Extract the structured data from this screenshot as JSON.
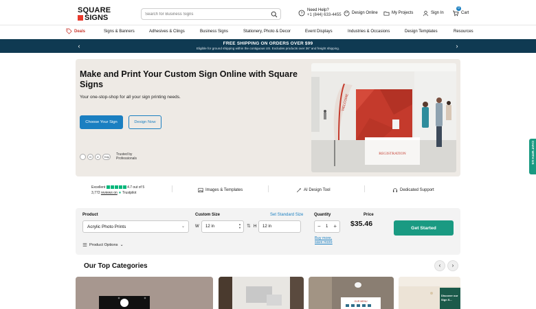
{
  "brand": {
    "line1": "SQUARE",
    "line2": "SIGNS",
    "accent": "#e8392c"
  },
  "search": {
    "placeholder": "Search for Business Signs"
  },
  "header": {
    "help_title": "Need Help?",
    "help_phone": "+1 (844) 633-4455",
    "design_online": "Design Online",
    "my_projects": "My Projects",
    "sign_in": "Sign In",
    "cart": "Cart",
    "cart_count": "0"
  },
  "nav": {
    "items": [
      "Deals",
      "Signs & Banners",
      "Adhesives & Clings",
      "Business Signs",
      "Stationery, Photo & Decor",
      "Event Displays",
      "Industries & Occasions",
      "Design Templates",
      "Resources"
    ]
  },
  "shipping": {
    "title": "FREE SHIPPING ON ORDERS OVER $99",
    "subtitle": "Eligible for ground shipping within the contiguous US. Excludes products over 36\" and freight shipping.",
    "bg": "#0f3a52"
  },
  "hero": {
    "title": "Make and Print Your Custom Sign Online with Square Signs",
    "subtitle": "Your one-stop-shop for all your sign printing needs.",
    "primary_cta": "Choose Your Sign",
    "secondary_cta": "Design Now",
    "trust_badges": [
      "G",
      "é",
      "Yelp"
    ],
    "trust_label": "Trusted by Professionals",
    "flag_text": "WELCOME",
    "table_text": "REGISTRATION"
  },
  "features": {
    "rating_label": "Excellent",
    "rating_score": "4.7 out of 5",
    "reviews": "3,772",
    "reviews_on": "reviews on",
    "trustpilot": "Trustpilot",
    "items": [
      "Images & Templates",
      "AI Design Tool",
      "Dedicated Support"
    ]
  },
  "config": {
    "product_label": "Product",
    "product_value": "Acrylic Photo Prints",
    "custom_size_label": "Custom Size",
    "set_standard": "Set Standard Size",
    "w_label": "W",
    "w_value": "12 in",
    "h_label": "H",
    "h_value": "12 in",
    "quantity_label": "Quantity",
    "quantity_value": "1",
    "buy_more": "Buy more,",
    "save_more": "save more",
    "price_label": "Price",
    "price_value": "$35.46",
    "cta": "Get Started",
    "product_options": "Product Options"
  },
  "categories": {
    "title": "Our Top Categories",
    "card3_text": "OUR MENU",
    "card4_text": "Discover our",
    "card4_text2": "Sign S..."
  },
  "side_tab": {
    "label": "CHAT WITH US"
  },
  "colors": {
    "primary": "#1a7fc1",
    "cta": "#1a9a82",
    "hero_bg": "#eeeae5"
  }
}
